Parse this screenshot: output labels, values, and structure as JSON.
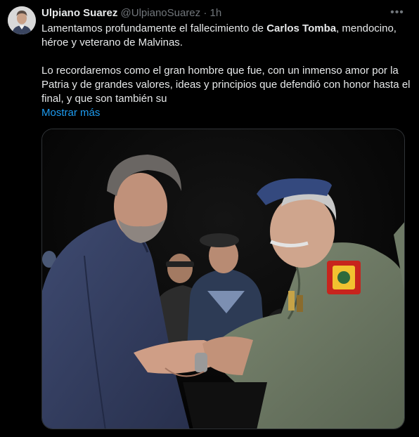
{
  "tweet": {
    "author_name": "Ulpiano Suarez",
    "author_handle": "@UlpianoSuarez",
    "separator": "·",
    "timestamp": "1h",
    "more_icon": "ellipsis-icon",
    "text_line1_prefix": "Lamentamos profundamente el fallecimiento de ",
    "text_line1_bold": "Carlos Tomba",
    "text_line1_suffix": ", mendocino, héroe y veterano de Malvinas.",
    "text_paragraph2": "Lo recordaremos como el gran hombre que fue, con un inmenso amor por la Patria y de grandes valores, ideas y principios que defendió con honor hasta el final, y que son también su",
    "show_more_label": "Mostrar más"
  },
  "colors": {
    "background": "#000000",
    "text": "#e7e9ea",
    "secondary_text": "#71767b",
    "link": "#1d9bf0",
    "border": "#2f3336"
  }
}
